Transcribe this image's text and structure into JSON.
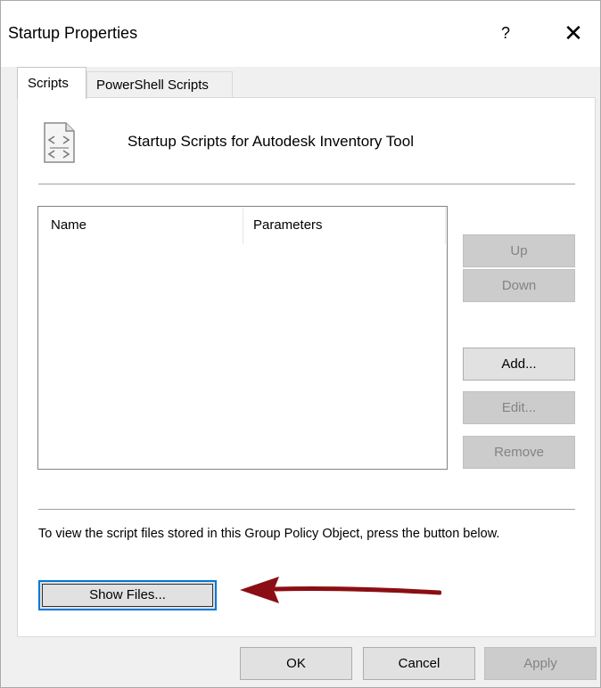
{
  "window": {
    "title": "Startup Properties",
    "help_label": "?",
    "close_label": "✕"
  },
  "tabs": [
    {
      "label": "Scripts",
      "active": true
    },
    {
      "label": "PowerShell Scripts",
      "active": false
    }
  ],
  "scripts_panel": {
    "heading": "Startup Scripts for Autodesk Inventory Tool",
    "icon": "script-file-icon",
    "columns": [
      "Name",
      "Parameters"
    ],
    "rows": [],
    "buttons": {
      "up": "Up",
      "down": "Down",
      "add": "Add...",
      "edit": "Edit...",
      "remove": "Remove"
    },
    "info_text": "To view the script files stored in this Group Policy Object, press the button below.",
    "show_files_label": "Show Files..."
  },
  "footer": {
    "ok": "OK",
    "cancel": "Cancel",
    "apply": "Apply"
  },
  "colors": {
    "focus_border": "#0078d7",
    "arrow": "#8b0e14",
    "disabled_text": "#838383"
  }
}
